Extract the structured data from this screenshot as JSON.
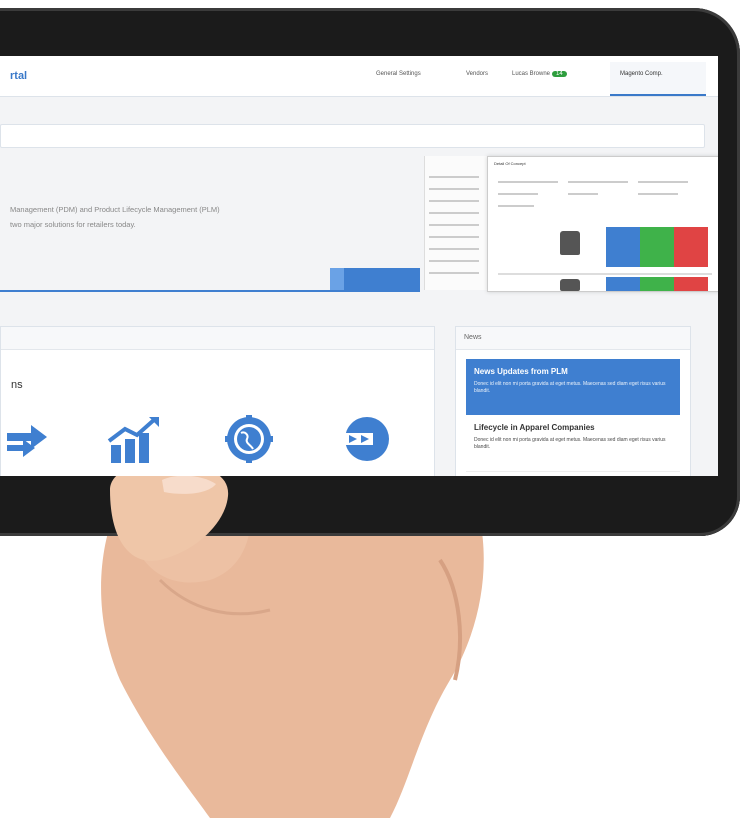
{
  "navbar": {
    "brand_fragment": "rtal",
    "items": [
      {
        "label": "General Settings"
      },
      {
        "label": "Vendors"
      },
      {
        "label": "Lucas Browne",
        "badge": "14"
      },
      {
        "label": "Magento Comp."
      }
    ]
  },
  "hero": {
    "line1": "Management (PDM) and Product Lifecycle Management (PLM)",
    "line2": "two major solutions for retailers today."
  },
  "mockup": {
    "title": "Detail Of Concept"
  },
  "section": {
    "heading_fragment": "ns",
    "icons": [
      "shuffle-icon",
      "growth-chart-icon",
      "globe-gear-icon",
      "arrow-circle-icon"
    ]
  },
  "news": {
    "title": "News",
    "items": [
      {
        "headline": "News Updates from PLM",
        "body": "Donec id elit non mi porta gravida at eget metus. Maecenas sed diam eget risus varius blandit."
      },
      {
        "headline": "Lifecycle in Apparel Companies",
        "body": "Donec id elit non mi porta gravida at eget metus. Maecenas sed diam eget risus varius blandit."
      }
    ]
  },
  "colors": {
    "accent": "#3f7fd0",
    "badge": "#2e9e3e",
    "bezel": "#1b1b1b"
  }
}
